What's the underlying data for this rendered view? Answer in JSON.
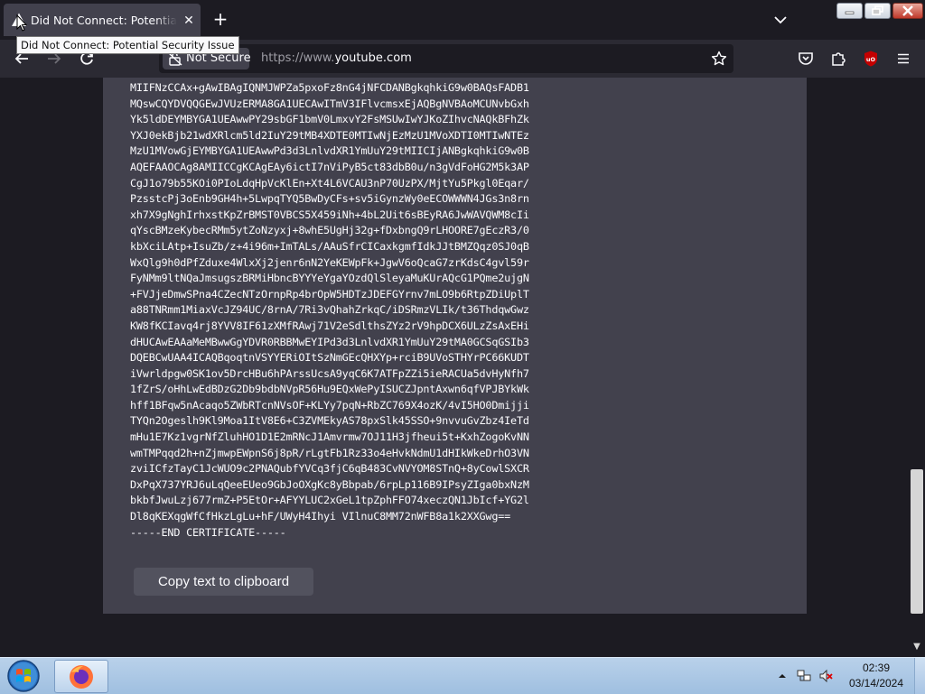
{
  "browser": {
    "tab": {
      "title": "Did Not Connect: Potential Security Issue",
      "tooltip": "Did Not Connect: Potential Security Issue"
    },
    "url": {
      "security_label": "Not Secure",
      "prefix": "https://www.",
      "host": "youtube.com"
    }
  },
  "certificate": {
    "text": "MIIFNzCCAx+gAwIBAgIQNMJWPZa5pxoFz8nG4jNFCDANBgkqhkiG9w0BAQsFADB1\nMQswCQYDVQQGEwJVUzERMA8GA1UECAwITmV3IFlvcmsxEjAQBgNVBAoMCUNvbGxh\nYk5ldDEYMBYGA1UEAwwPY29sbGF1bmV0LmxvY2FsMSUwIwYJKoZIhvcNAQkBFhZk\nYXJ0ekBjb21wdXRlcm5ld2IuY29tMB4XDTE0MTIwNjEzMzU1MVoXDTI0MTIwNTEz\nMzU1MVowGjEYMBYGA1UEAwwPd3d3LnlvdXR1YmUuY29tMIICIjANBgkqhkiG9w0B\nAQEFAAOCAg8AMIICCgKCAgEAy6ictI7nViPyB5ct83dbB0u/n3gVdFoHG2M5k3AP\nCgJ1o79b55KOi0PIoLdqHpVcKlEn+Xt4L6VCAU3nP70UzPX/MjtYu5Pkgl0Eqar/\nPzsstcPj3oEnb9GH4h+5LwpqTYQ5BwDyCFs+sv5iGynzWy0eECOWWWN4JGs3n8rn\nxh7X9gNghIrhxstKpZrBMST0VBCS5X459iNh+4bL2Uit6sBEyRA6JwWAVQWM8cIi\nqYscBMzeKybecRMm5ytZoNzyxj+8whE5UgHj32g+fDxbngQ9rLHOORE7gEczR3/0\nkbXciLAtp+IsuZb/z+4i96m+ImTALs/AAuSfrCICaxkgmfIdkJJtBMZQqz0SJ0qB\nWxQlg9h0dPfZduxe4WlxXj2jenr6nN2YeKEWpFk+JgwV6oQcaG7zrKdsC4gvl59r\nFyNMm9ltNQaJmsugszBRMiHbncBYYYeYgaYOzdQlSleyaMuKUrAQcG1PQme2ujgN\n+FVJjeDmwSPna4CZecNTzOrnpRp4brOpW5HDTzJDEFGYrnv7mLO9b6RtpZDiUplT\na88TNRmm1MiaxVcJZ94UC/8rnA/7Ri3vQhahZrkqC/iDSRmzVLIk/t36ThdqwGwz\nKW8fKCIavq4rj8YVV8IF61zXMfRAwj71V2eSdlthsZYz2rV9hpDCX6ULzZsAxEHi\ndHUCAwEAAaMeMBwwGgYDVR0RBBMwEYIPd3d3LnlvdXR1YmUuY29tMA0GCSqGSIb3\nDQEBCwUAA4ICAQBqoqtnVSYYERiOItSzNmGEcQHXYp+rciB9UVoSTHYrPC66KUDT\niVwrldpgw0SK1ov5DrcHBu6hPArssUcsA9yqC6K7ATFpZZi5ieRACUa5dvHyNfh7\n1fZrS/oHhLwEdBDzG2Db9bdbNVpR56Hu9EQxWePyISUCZJpntAxwn6qfVPJBYkWk\nhff1BFqw5nAcaqo5ZWbRTcnNVsOF+KLYy7pqN+RbZC769X4ozK/4vI5HO0Dmijji\nTYQn2Ogeslh9Kl9Moa1ItV8E6+C3ZVMEkyAS78pxSlk45SSO+9nvvuGvZbz4IeTd\nmHu1E7Kz1vgrNfZluhHO1D1E2mRNcJ1Amvrmw7OJ11H3jfheui5t+KxhZogoKvNN\nwmTMPqqd2h+nZjmwpEWpnS6j8pR/rLgtFb1Rz33o4eHvkNdmU1dHIkWkeDrhO3VN\nzviICfzTayC1JcWUO9c2PNAQubfYVCq3fjC6qB483CvNVYOM8STnQ+8yCowlSXCR\nDxPqX737YRJ6uLqQeeEUeo9GbJoOXgKc8yBbpab/6rpLp116B9IPsyZIga0bxNzM\nbkbfJwuLzj677rmZ+P5EtOr+AFYYLUC2xGeL1tpZphFFO74xeczQN1JbIcf+YG2l\nDl8qKEXqgWfCfHkzLgLu+hF/UWyH4Ihyi VIlnuC8MM72nWFB8a1k2XXGwg==\n-----END CERTIFICATE-----",
    "copy_button_label": "Copy text to clipboard"
  },
  "taskbar": {
    "time": "02:39",
    "date": "03/14/2024"
  },
  "icons": {
    "tab_icon": "warning-icon",
    "back": "back-arrow-icon",
    "forward": "forward-arrow-icon",
    "reload": "reload-icon",
    "bookmark": "star-icon",
    "pocket": "pocket-icon",
    "extensions": "puzzle-icon",
    "ublock": "ublock-origin-icon",
    "menu": "hamburger-menu-icon"
  },
  "colors": {
    "page_background": "#1c1b22",
    "panel_background": "#42414d",
    "text": "#fbfbfe",
    "ublock_red": "#c40000"
  }
}
